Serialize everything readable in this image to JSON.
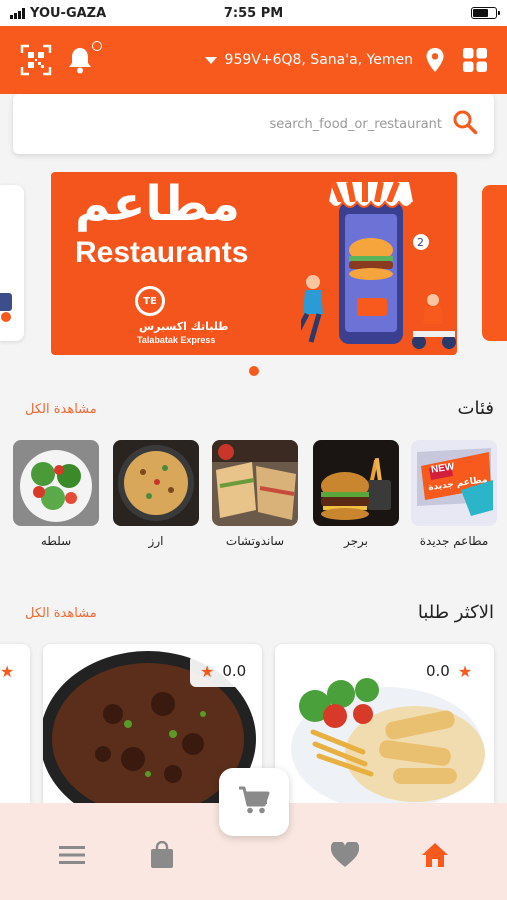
{
  "status_bar": {
    "carrier": "YOU-GAZA",
    "time": "7:55 PM"
  },
  "header": {
    "location": "959V+6Q8, Sana'a, Yemen",
    "icons": [
      "qr-code-icon",
      "bell-icon",
      "caret-down-icon",
      "location-pin-icon",
      "grid-icon"
    ]
  },
  "search": {
    "placeholder": "search_food_or_restaurant"
  },
  "banner": {
    "title_ar": "مطاعم",
    "title_en": "Restaurants",
    "brand_ar": "طلباتك اكسبرس",
    "brand_en": "Talabatak Express",
    "logo_text": "TE"
  },
  "categories": {
    "title": "فئات",
    "view_all": "مشاهدة الكل",
    "items": [
      {
        "label": "مطاعم جديدة"
      },
      {
        "label": "برجر"
      },
      {
        "label": "ساندوتشات"
      },
      {
        "label": "ارز"
      },
      {
        "label": "سلطه"
      }
    ],
    "new_badge": {
      "en": "NEW",
      "ar": "مطاعم جديدة"
    }
  },
  "popular": {
    "title": "الاكثر طلبا",
    "view_all": "مشاهدة الكل",
    "items": [
      {
        "rating": "0.0"
      },
      {
        "rating": "0.0"
      }
    ]
  },
  "bottom_nav": {
    "items": [
      "menu-icon",
      "bag-icon",
      "cart-icon",
      "heart-icon",
      "home-icon"
    ],
    "accent": "#f85a1e",
    "inactive": "#8a8a8a"
  },
  "colors": {
    "brand": "#f85a1e",
    "nav_bg": "#fbe7e1"
  }
}
